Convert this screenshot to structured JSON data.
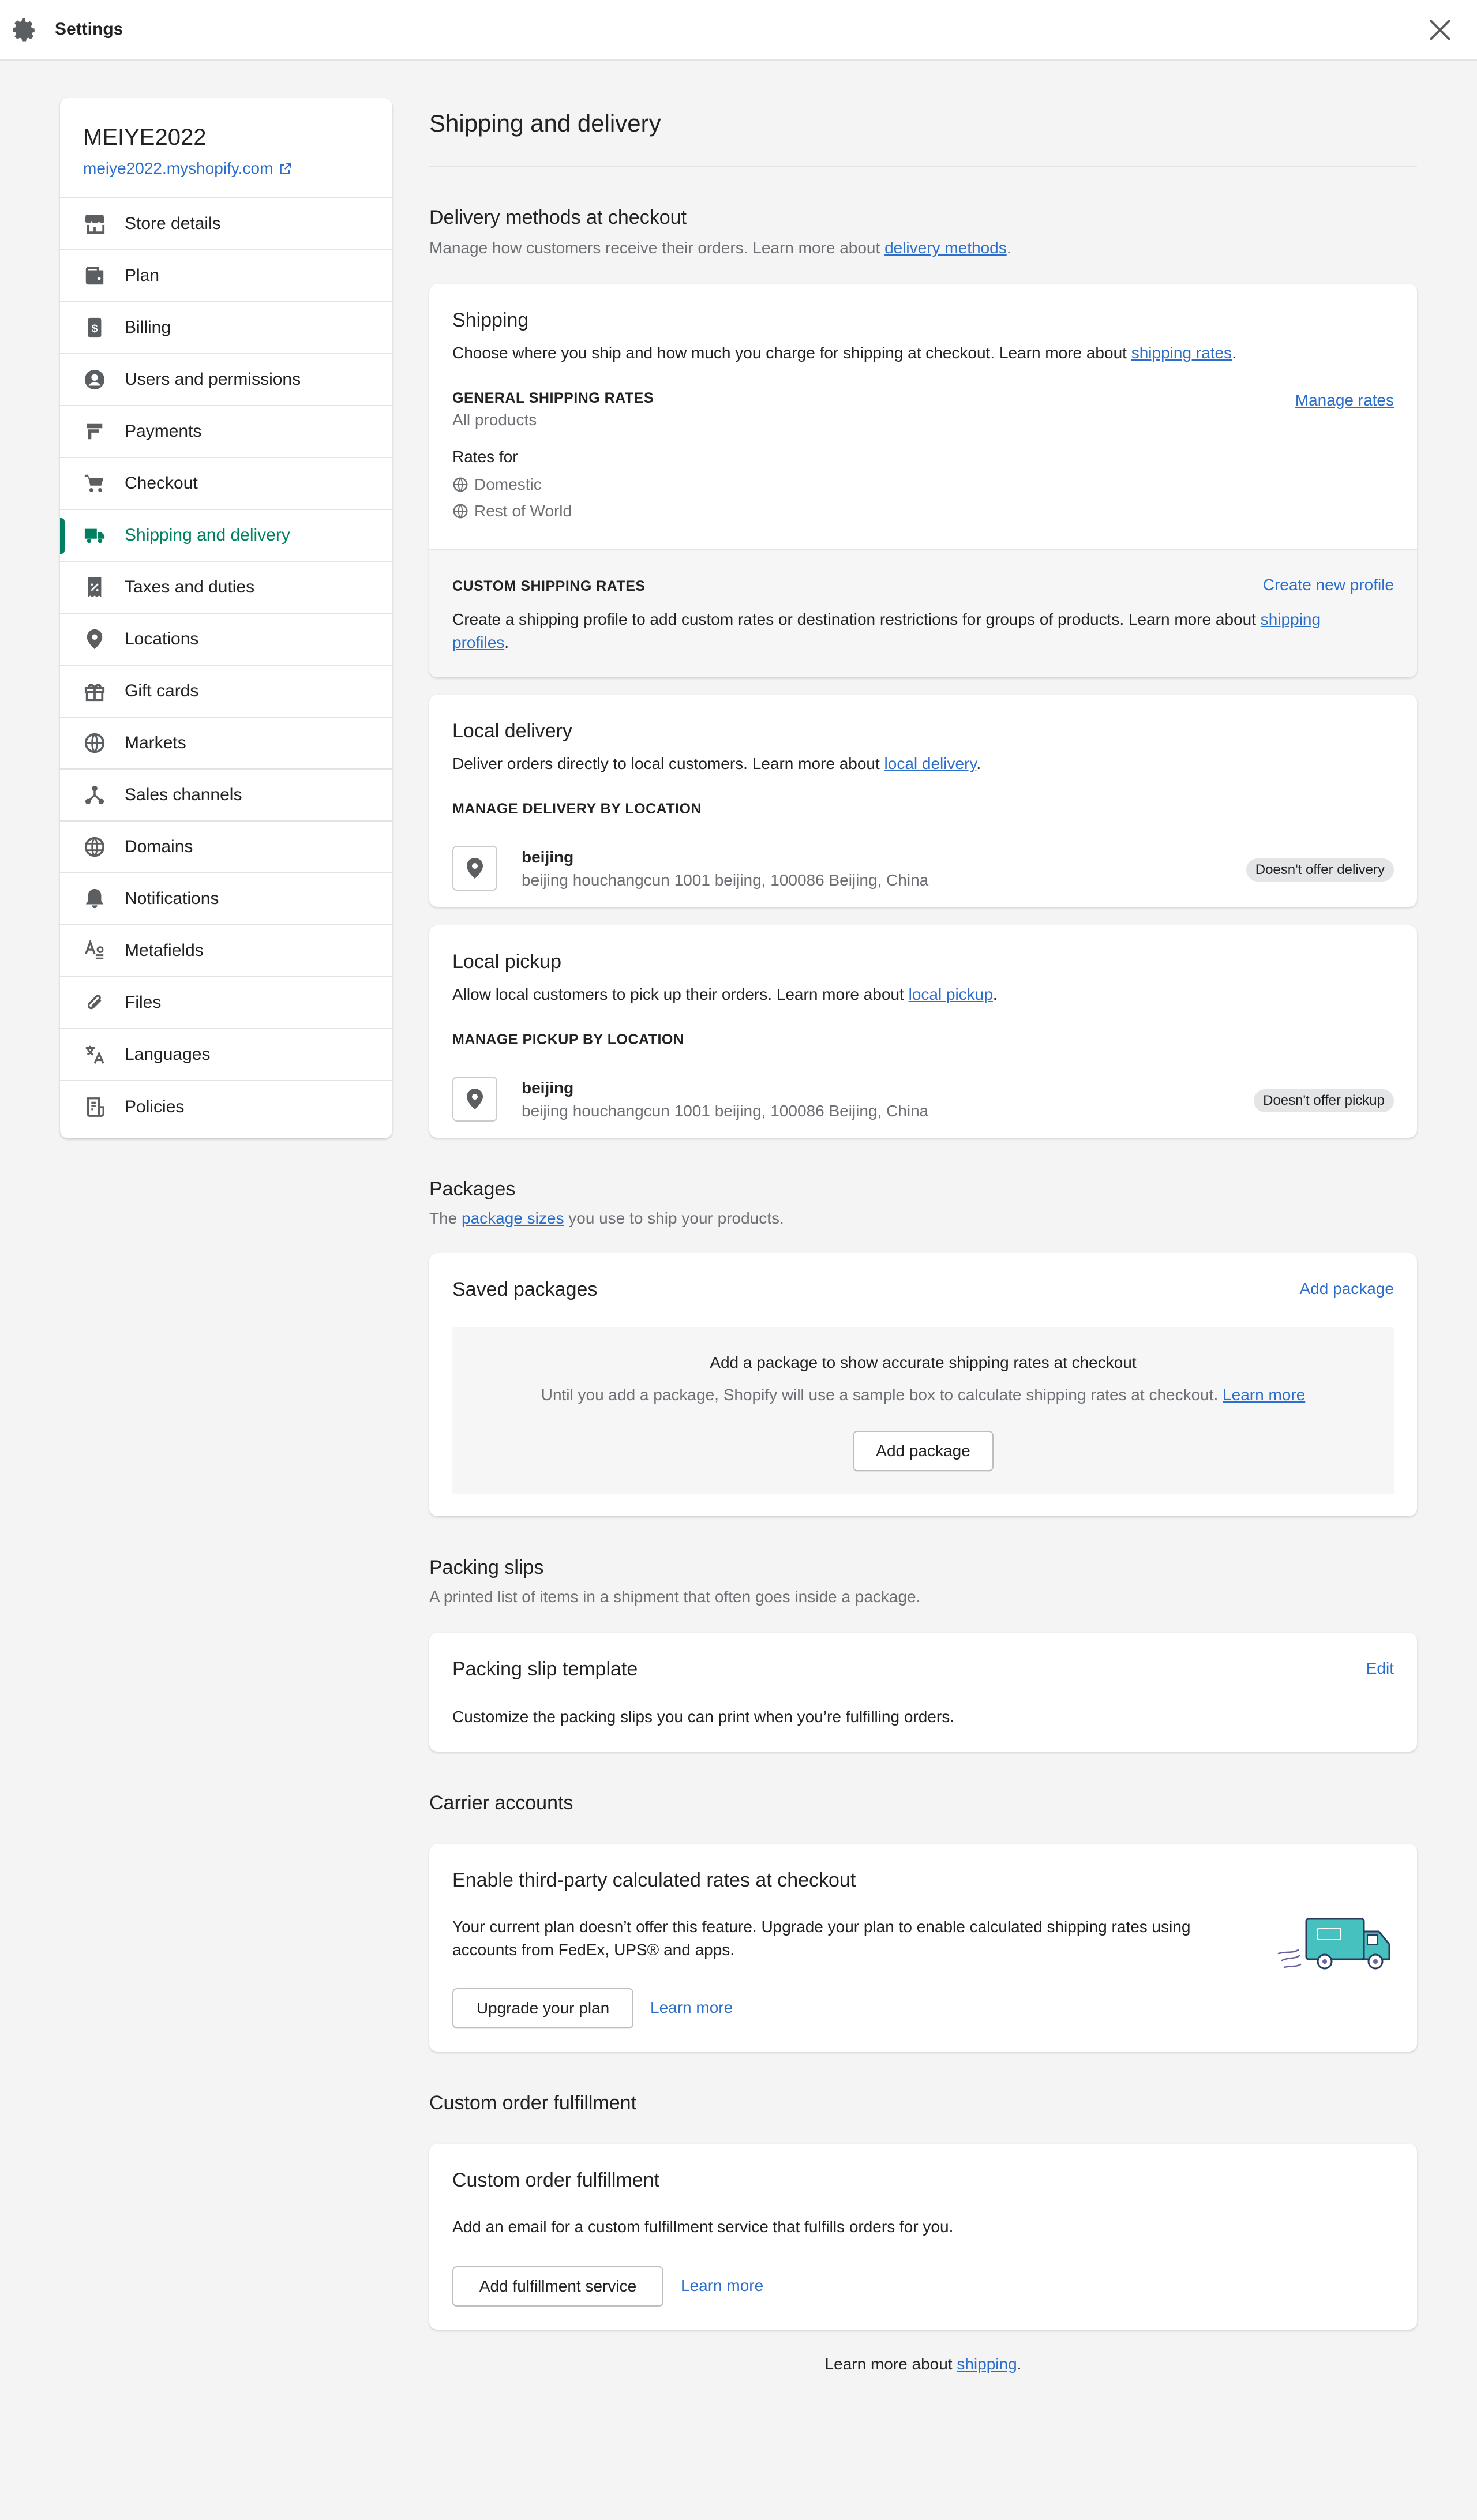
{
  "header": {
    "title": "Settings"
  },
  "store": {
    "name": "MEIYE2022",
    "url": "meiye2022.myshopify.com"
  },
  "sidebar": {
    "items": [
      {
        "label": "Store details",
        "icon": "store-icon"
      },
      {
        "label": "Plan",
        "icon": "plan-icon"
      },
      {
        "label": "Billing",
        "icon": "billing-icon"
      },
      {
        "label": "Users and permissions",
        "icon": "user-icon"
      },
      {
        "label": "Payments",
        "icon": "payments-icon"
      },
      {
        "label": "Checkout",
        "icon": "cart-icon"
      },
      {
        "label": "Shipping and delivery",
        "icon": "truck-icon",
        "active": true
      },
      {
        "label": "Taxes and duties",
        "icon": "receipt-icon"
      },
      {
        "label": "Locations",
        "icon": "location-icon"
      },
      {
        "label": "Gift cards",
        "icon": "gift-icon"
      },
      {
        "label": "Markets",
        "icon": "globe-icon"
      },
      {
        "label": "Sales channels",
        "icon": "channels-icon"
      },
      {
        "label": "Domains",
        "icon": "domain-icon"
      },
      {
        "label": "Notifications",
        "icon": "bell-icon"
      },
      {
        "label": "Metafields",
        "icon": "metafields-icon"
      },
      {
        "label": "Files",
        "icon": "paperclip-icon"
      },
      {
        "label": "Languages",
        "icon": "translate-icon"
      },
      {
        "label": "Policies",
        "icon": "policy-icon"
      }
    ],
    "active_color": "#008060"
  },
  "main": {
    "title": "Shipping and delivery",
    "delivery": {
      "title": "Delivery methods at checkout",
      "desc_prefix": "Manage how customers receive their orders. Learn more about ",
      "desc_link": "delivery methods",
      "desc_suffix": "."
    },
    "shipping": {
      "title": "Shipping",
      "desc_prefix": "Choose where you ship and how much you charge for shipping at checkout. Learn more about ",
      "desc_link": "shipping rates",
      "desc_suffix": ".",
      "general_label": "GENERAL SHIPPING RATES",
      "general_sub": "All products",
      "manage_rates": "Manage rates",
      "rates_for": "Rates for",
      "zones": [
        "Domestic",
        "Rest of World"
      ],
      "custom_label": "CUSTOM SHIPPING RATES",
      "create_profile": "Create new profile",
      "custom_desc_prefix": "Create a shipping profile to add custom rates or destination restrictions for groups of products. Learn more about ",
      "custom_link_1": "shipping",
      "custom_link_2": "profiles",
      "custom_desc_suffix": "."
    },
    "local_delivery": {
      "title": "Local delivery",
      "desc_prefix": "Deliver orders directly to local customers. Learn more about ",
      "desc_link": "local delivery",
      "desc_suffix": ".",
      "manage_label": "MANAGE DELIVERY BY LOCATION",
      "location_name": "beijing",
      "location_address": "beijing houchangcun 1001 beijing, 100086 Beijing, China",
      "badge": "Doesn't offer delivery"
    },
    "local_pickup": {
      "title": "Local pickup",
      "desc_prefix": "Allow local customers to pick up their orders. Learn more about ",
      "desc_link": "local pickup",
      "desc_suffix": ".",
      "manage_label": "MANAGE PICKUP BY LOCATION",
      "location_name": "beijing",
      "location_address": "beijing houchangcun 1001 beijing, 100086 Beijing, China",
      "badge": "Doesn't offer pickup"
    },
    "packages": {
      "title": "Packages",
      "desc_prefix": "The ",
      "desc_link": "package sizes",
      "desc_suffix": " you use to ship your products.",
      "card_title": "Saved packages",
      "add_link": "Add package",
      "empty_title": "Add a package to show accurate shipping rates at checkout",
      "empty_desc": "Until you add a package, Shopify will use a sample box to calculate shipping rates at checkout. ",
      "empty_link": "Learn more",
      "add_button": "Add package"
    },
    "packing": {
      "title": "Packing slips",
      "desc": "A printed list of items in a shipment that often goes inside a package.",
      "card_title": "Packing slip template",
      "edit": "Edit",
      "card_desc": "Customize the packing slips you can print when you’re fulfilling orders."
    },
    "carrier": {
      "title": "Carrier accounts",
      "card_title": "Enable third-party calculated rates at checkout",
      "desc_line1": "Your current plan doesn’t offer this feature. Upgrade your plan to enable calculated shipping rates using",
      "desc_line2": "accounts from FedEx, UPS® and apps.",
      "upgrade_button": "Upgrade your plan",
      "learn_more": "Learn more"
    },
    "custom_fulfillment": {
      "title": "Custom order fulfillment",
      "card_title": "Custom order fulfillment",
      "desc": "Add an email for a custom fulfillment service that fulfills orders for you.",
      "button": "Add fulfillment service",
      "learn_more": "Learn more"
    },
    "footer": {
      "prefix": "Learn more about ",
      "link": "shipping",
      "suffix": "."
    }
  }
}
